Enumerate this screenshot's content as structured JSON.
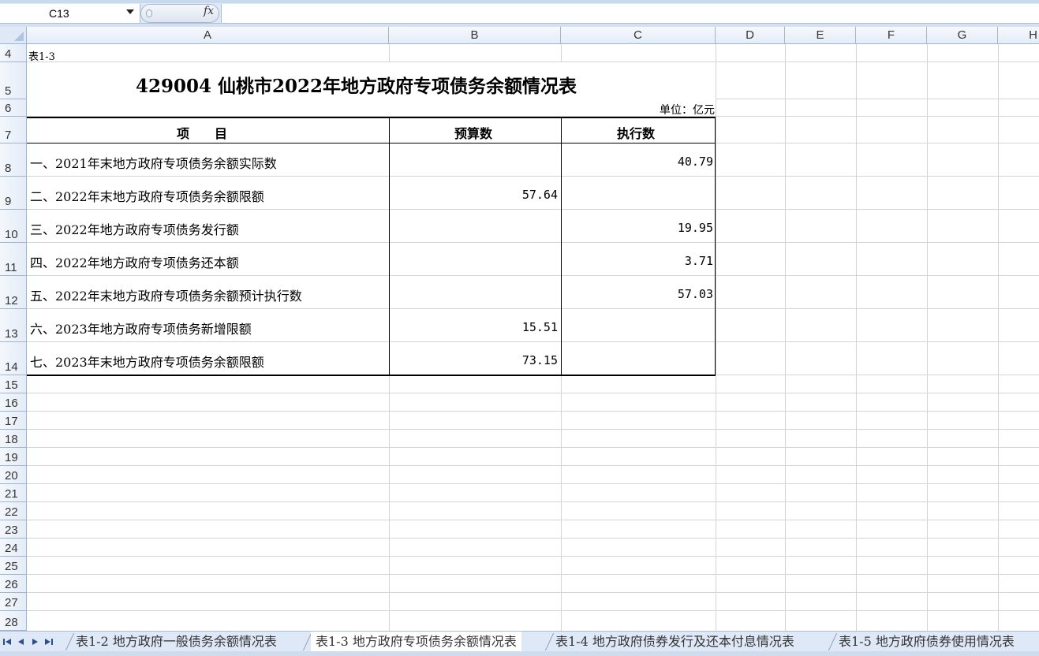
{
  "formula_bar": {
    "name_box": "C13",
    "fx_label": "fx",
    "formula": ""
  },
  "columns": [
    "A",
    "B",
    "C",
    "D",
    "E",
    "F",
    "G",
    "H"
  ],
  "rows": [
    "4",
    "5",
    "6",
    "7",
    "8",
    "9",
    "10",
    "11",
    "12",
    "13",
    "14",
    "15",
    "16",
    "17",
    "18",
    "19",
    "20",
    "21",
    "22",
    "23",
    "24",
    "25",
    "26",
    "27",
    "28"
  ],
  "sheet": {
    "table_label": "表1-3",
    "title": "429004 仙桃市2022年地方政府专项债务余额情况表",
    "unit": "单位：亿元",
    "headers": {
      "item": "项　　目",
      "budget": "预算数",
      "actual": "执行数"
    },
    "data_rows": [
      {
        "item": "一、2021年末地方政府专项债务余额实际数",
        "budget": "",
        "actual": "40.79"
      },
      {
        "item": "二、2022年末地方政府专项债务余额限额",
        "budget": "57.64",
        "actual": ""
      },
      {
        "item": "三、2022年地方政府专项债务发行额",
        "budget": "",
        "actual": "19.95"
      },
      {
        "item": "四、2022年地方政府专项债务还本额",
        "budget": "",
        "actual": "3.71"
      },
      {
        "item": "五、2022年末地方政府专项债务余额预计执行数",
        "budget": "",
        "actual": "57.03"
      },
      {
        "item": "六、2023年地方政府专项债务新增限额",
        "budget": "15.51",
        "actual": ""
      },
      {
        "item": "七、2023年末地方政府专项债务余额限额",
        "budget": "73.15",
        "actual": ""
      }
    ]
  },
  "sheet_tabs": [
    {
      "label": "表1-2 地方政府一般债务余额情况表",
      "active": false
    },
    {
      "label": "表1-3 地方政府专项债务余额情况表",
      "active": true
    },
    {
      "label": "表1-4 地方政府债券发行及还本付息情况表",
      "active": false
    },
    {
      "label": "表1-5 地方政府债券使用情况表",
      "active": false
    }
  ]
}
